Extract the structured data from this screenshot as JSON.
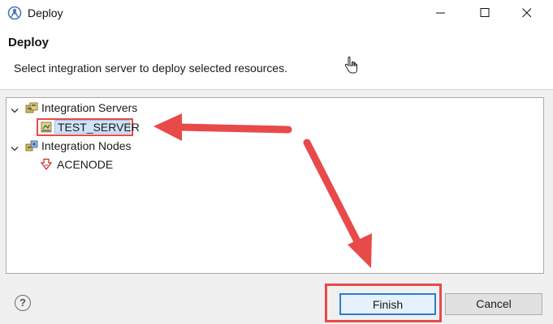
{
  "window": {
    "title": "Deploy",
    "controls": {
      "minimize": "minimize",
      "maximize": "maximize",
      "close": "close"
    }
  },
  "header": {
    "title": "Deploy",
    "description": "Select integration server to deploy selected resources."
  },
  "tree": {
    "items": [
      {
        "label": "Integration Servers",
        "expanded": true,
        "icon": "integration-servers-icon",
        "children": [
          {
            "label": "TEST_SERVER",
            "selected": true,
            "icon": "server-icon"
          }
        ]
      },
      {
        "label": "Integration Nodes",
        "expanded": true,
        "icon": "integration-nodes-icon",
        "children": [
          {
            "label": "ACENODE",
            "icon": "node-icon"
          }
        ]
      }
    ]
  },
  "footer": {
    "help_glyph": "?",
    "finish_label": "Finish",
    "cancel_label": "Cancel"
  },
  "colors": {
    "annotation_red": "#e84a4a",
    "selection_fill": "#cfe3f7",
    "default_button_border": "#2b7bd6"
  }
}
